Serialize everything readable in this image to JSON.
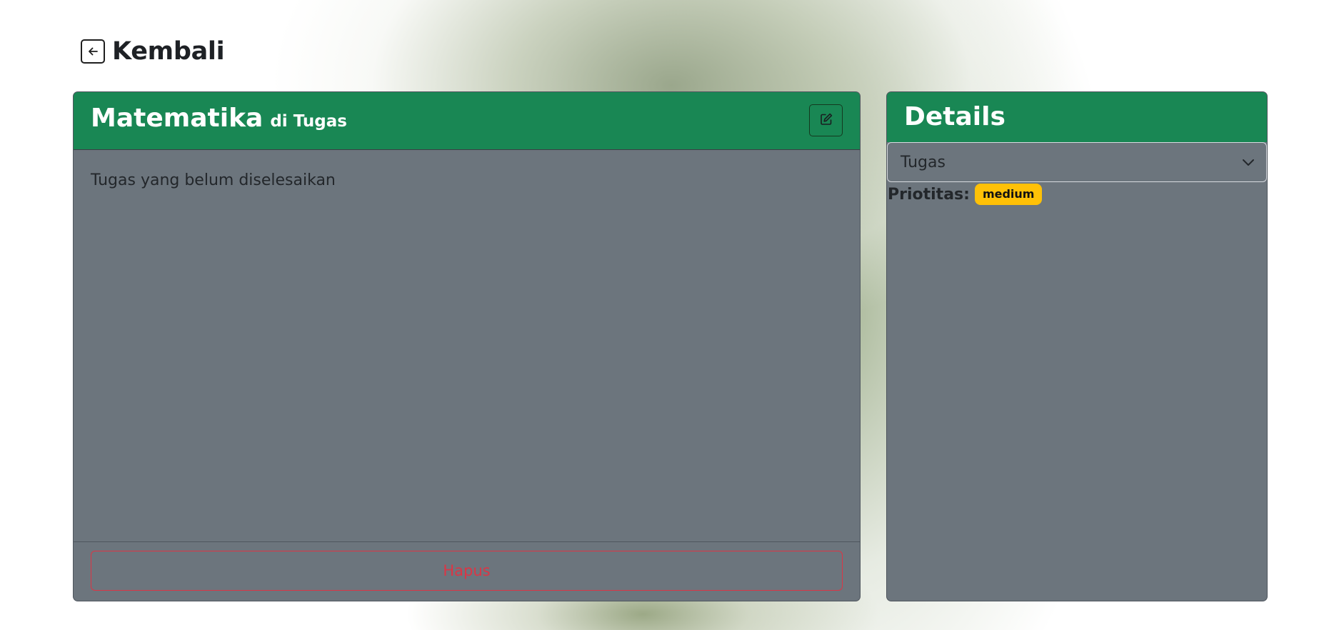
{
  "nav": {
    "back_label": "Kembali",
    "back_icon": "arrow-left-square-icon"
  },
  "task": {
    "title": "Matematika",
    "category_prefix": "di Tugas",
    "description": "Tugas yang belum diselesaikan",
    "edit_icon": "pencil-square-icon",
    "delete_label": "Hapus"
  },
  "details": {
    "heading": "Details",
    "select_value": "Tugas",
    "priority_label": "Priotitas:",
    "priority_value": "medium"
  },
  "colors": {
    "header_green": "#198754",
    "card_gray": "#6c757d",
    "danger": "#dc3545",
    "badge_warning": "#ffc107"
  }
}
